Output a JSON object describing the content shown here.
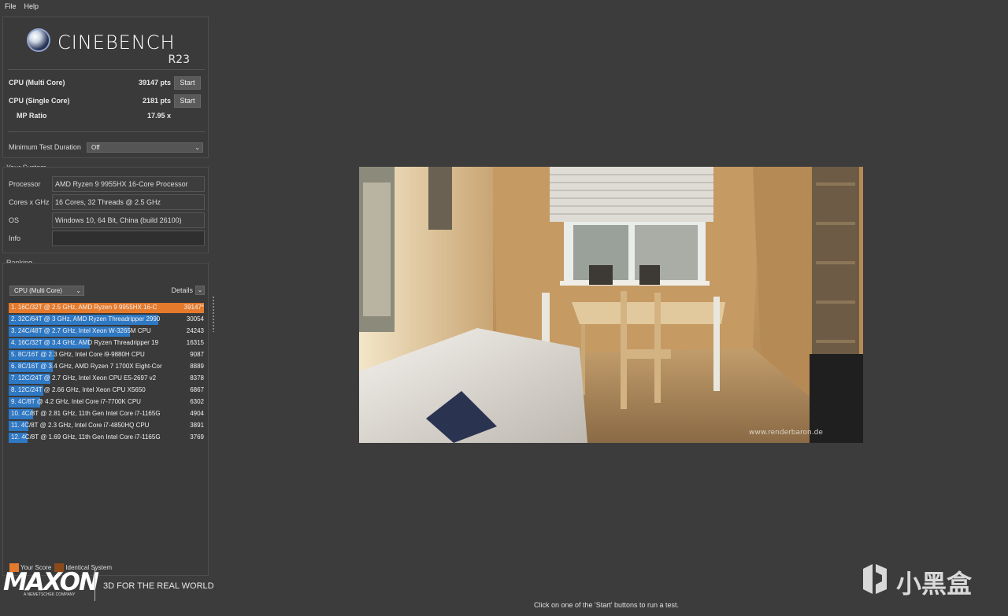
{
  "menu": {
    "file": "File",
    "help": "Help"
  },
  "logo": {
    "brand": "CINEBENCH",
    "version": "R23"
  },
  "bench": {
    "multi": {
      "label": "CPU (Multi Core)",
      "value": "39147 pts",
      "button": "Start"
    },
    "single": {
      "label": "CPU (Single Core)",
      "value": "2181 pts",
      "button": "Start"
    },
    "mp": {
      "label": "MP Ratio",
      "value": "17.95 x"
    },
    "duration": {
      "label": "Minimum Test Duration",
      "value": "Off"
    }
  },
  "system": {
    "title": "Your System",
    "rows": [
      {
        "label": "Processor",
        "value": "AMD Ryzen 9 9955HX 16-Core Processor"
      },
      {
        "label": "Cores x GHz",
        "value": "16 Cores, 32 Threads @ 2.5 GHz"
      },
      {
        "label": "OS",
        "value": "Windows 10, 64 Bit, China (build 26100)"
      },
      {
        "label": "Info",
        "value": ""
      }
    ]
  },
  "ranking": {
    "title": "Ranking",
    "mode": "CPU (Multi Core)",
    "details": "Details",
    "items": [
      {
        "text": "1. 16C/32T @ 2.5 GHz, AMD Ryzen 9 9955HX 16-C",
        "score": "39147*",
        "value": 39147,
        "mine": true
      },
      {
        "text": "2. 32C/64T @ 3 GHz, AMD Ryzen Threadripper 2990",
        "score": "30054",
        "value": 30054,
        "mine": false
      },
      {
        "text": "3. 24C/48T @ 2.7 GHz, Intel Xeon W-3265M CPU",
        "score": "24243",
        "value": 24243,
        "mine": false
      },
      {
        "text": "4. 16C/32T @ 3.4 GHz, AMD Ryzen Threadripper 19",
        "score": "16315",
        "value": 16315,
        "mine": false
      },
      {
        "text": "5. 8C/16T @ 2.3 GHz, Intel Core i9-9880H CPU",
        "score": "9087",
        "value": 9087,
        "mine": false
      },
      {
        "text": "6. 8C/16T @ 3.4 GHz, AMD Ryzen 7 1700X Eight-Cor",
        "score": "8889",
        "value": 8889,
        "mine": false
      },
      {
        "text": "7. 12C/24T @ 2.7 GHz, Intel Xeon CPU E5-2697 v2",
        "score": "8378",
        "value": 8378,
        "mine": false
      },
      {
        "text": "8. 12C/24T @ 2.66 GHz, Intel Xeon CPU X5650",
        "score": "6867",
        "value": 6867,
        "mine": false
      },
      {
        "text": "9. 4C/8T @ 4.2 GHz, Intel Core i7-7700K CPU",
        "score": "6302",
        "value": 6302,
        "mine": false
      },
      {
        "text": "10. 4C/8T @ 2.81 GHz, 11th Gen Intel Core i7-1165G",
        "score": "4904",
        "value": 4904,
        "mine": false
      },
      {
        "text": "11. 4C/8T @ 2.3 GHz, Intel Core i7-4850HQ CPU",
        "score": "3891",
        "value": 3891,
        "mine": false
      },
      {
        "text": "12. 4C/8T @ 1.69 GHz, 11th Gen Intel Core i7-1165G",
        "score": "3769",
        "value": 3769,
        "mine": false
      }
    ],
    "legend": {
      "your": "Your Score",
      "identical": "Identical System"
    }
  },
  "footer": {
    "brand": "MAXON",
    "sub": "A NEMETSCHEK COMPANY",
    "tagline": "3D FOR THE REAL WORLD"
  },
  "render": {
    "credit": "www.renderbaron.de"
  },
  "status": "Click on one of the 'Start' buttons to run a test.",
  "watermark": {
    "text": "小黑盒"
  },
  "colors": {
    "mine_bar": "#e57a2c",
    "bar": "#2e78c4",
    "identical": "#8b4a1a",
    "background": "#3c3c3c"
  }
}
